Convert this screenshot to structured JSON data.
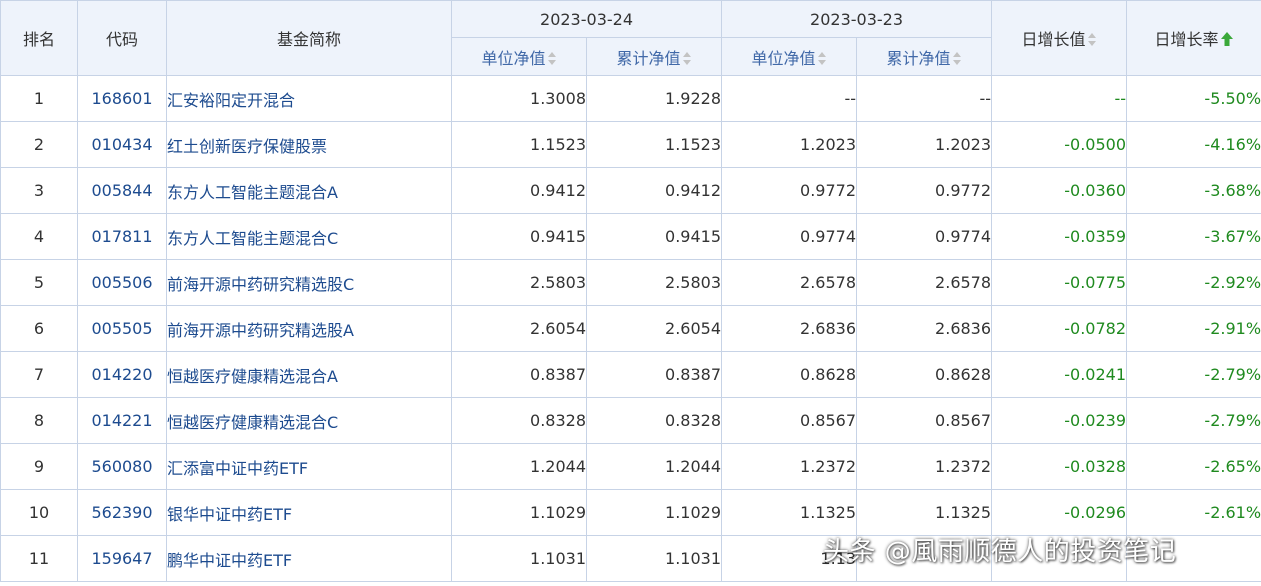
{
  "header": {
    "rank": "排名",
    "code": "代码",
    "name": "基金简称",
    "date1": "2023-03-24",
    "date2": "2023-03-23",
    "unit_nav": "单位净值",
    "accum_nav": "累计净值",
    "daily_change": "日增长值",
    "daily_rate": "日增长率"
  },
  "colors": {
    "header_bg": "#eef3fb",
    "border": "#c7d3e6",
    "link": "#1d4b8f",
    "negative": "#1f8a1f",
    "sort_active": "#3aa83a"
  },
  "rows": [
    {
      "rank": "1",
      "code": "168601",
      "name": "汇安裕阳定开混合",
      "nav1": "1.3008",
      "acc1": "1.9228",
      "nav2": "--",
      "acc2": "--",
      "change": "--",
      "rate": "-5.50%"
    },
    {
      "rank": "2",
      "code": "010434",
      "name": "红土创新医疗保健股票",
      "nav1": "1.1523",
      "acc1": "1.1523",
      "nav2": "1.2023",
      "acc2": "1.2023",
      "change": "-0.0500",
      "rate": "-4.16%"
    },
    {
      "rank": "3",
      "code": "005844",
      "name": "东方人工智能主题混合A",
      "nav1": "0.9412",
      "acc1": "0.9412",
      "nav2": "0.9772",
      "acc2": "0.9772",
      "change": "-0.0360",
      "rate": "-3.68%"
    },
    {
      "rank": "4",
      "code": "017811",
      "name": "东方人工智能主题混合C",
      "nav1": "0.9415",
      "acc1": "0.9415",
      "nav2": "0.9774",
      "acc2": "0.9774",
      "change": "-0.0359",
      "rate": "-3.67%"
    },
    {
      "rank": "5",
      "code": "005506",
      "name": "前海开源中药研究精选股C",
      "nav1": "2.5803",
      "acc1": "2.5803",
      "nav2": "2.6578",
      "acc2": "2.6578",
      "change": "-0.0775",
      "rate": "-2.92%"
    },
    {
      "rank": "6",
      "code": "005505",
      "name": "前海开源中药研究精选股A",
      "nav1": "2.6054",
      "acc1": "2.6054",
      "nav2": "2.6836",
      "acc2": "2.6836",
      "change": "-0.0782",
      "rate": "-2.91%"
    },
    {
      "rank": "7",
      "code": "014220",
      "name": "恒越医疗健康精选混合A",
      "nav1": "0.8387",
      "acc1": "0.8387",
      "nav2": "0.8628",
      "acc2": "0.8628",
      "change": "-0.0241",
      "rate": "-2.79%"
    },
    {
      "rank": "8",
      "code": "014221",
      "name": "恒越医疗健康精选混合C",
      "nav1": "0.8328",
      "acc1": "0.8328",
      "nav2": "0.8567",
      "acc2": "0.8567",
      "change": "-0.0239",
      "rate": "-2.79%"
    },
    {
      "rank": "9",
      "code": "560080",
      "name": "汇添富中证中药ETF",
      "nav1": "1.2044",
      "acc1": "1.2044",
      "nav2": "1.2372",
      "acc2": "1.2372",
      "change": "-0.0328",
      "rate": "-2.65%"
    },
    {
      "rank": "10",
      "code": "562390",
      "name": "银华中证中药ETF",
      "nav1": "1.1029",
      "acc1": "1.1029",
      "nav2": "1.1325",
      "acc2": "1.1325",
      "change": "-0.0296",
      "rate": "-2.61%"
    },
    {
      "rank": "11",
      "code": "159647",
      "name": "鹏华中证中药ETF",
      "nav1": "1.1031",
      "acc1": "1.1031",
      "nav2": "1.13",
      "acc2": "",
      "change": "",
      "rate": ""
    }
  ],
  "watermark": "头条 @風雨顺德人的投资笔记"
}
